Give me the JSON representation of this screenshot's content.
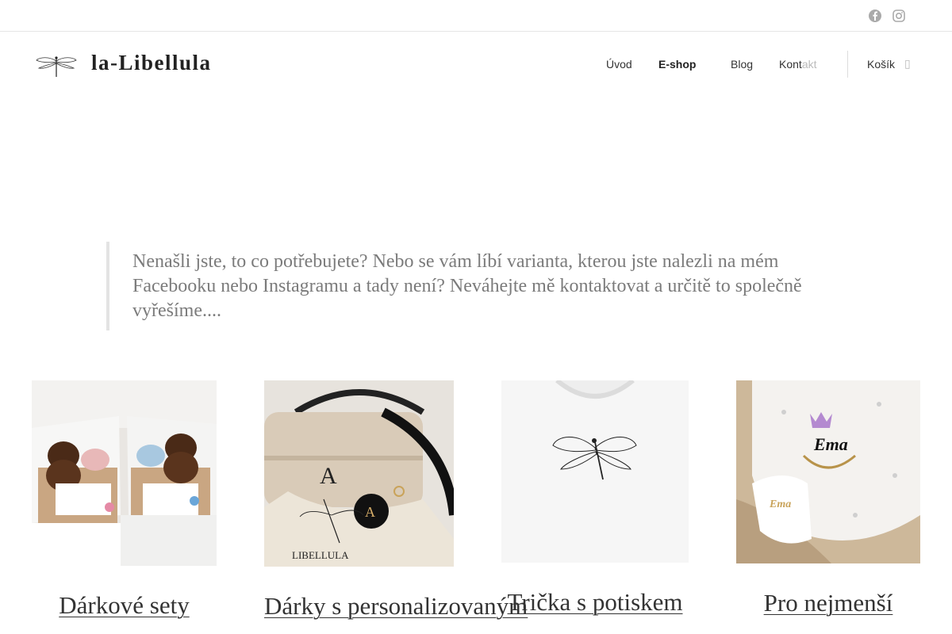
{
  "social": [
    {
      "name": "facebook-icon"
    },
    {
      "name": "instagram-icon"
    }
  ],
  "site": {
    "title": "la-Libellula"
  },
  "nav": {
    "uvod": "Úvod",
    "eshop": "E-shop",
    "blog": "Blog",
    "kontakt_main": "Kont",
    "kontakt_fade": "akt",
    "cart": "Košík",
    "cart_icon": "bag-icon"
  },
  "quote": {
    "text": "Nenašli jste, to co potřebujete? Nebo se vám líbí varianta, kterou jste nalezli na mém Facebooku nebo Instagramu a tady není? Neváhejte mě kontaktovat a určitě to společně vyřešíme...."
  },
  "categories": [
    {
      "title": "Dárkové sety"
    },
    {
      "title": "Dárky s personalizovaným"
    },
    {
      "title": "Trička s potiskem"
    },
    {
      "title": "Pro nejmenší"
    }
  ],
  "colors": {
    "text": "#333333",
    "quote_text": "#7b7b7b",
    "quote_border": "#e3e3e3",
    "icon_gray": "#aaaaaa"
  }
}
